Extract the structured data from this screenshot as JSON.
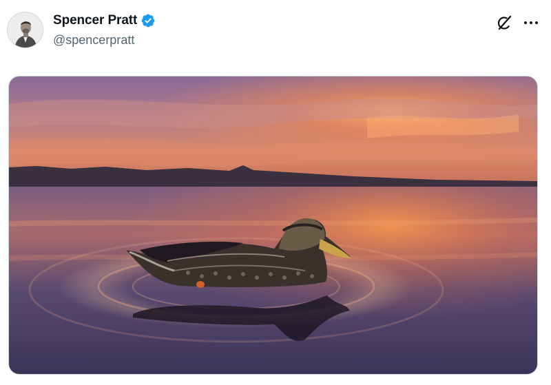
{
  "tweet": {
    "author": {
      "display_name": "Spencer Pratt",
      "handle": "@spencerpratt",
      "verified": true,
      "avatar_icon": "profile-photo"
    },
    "actions": {
      "grok_icon": "grok-icon",
      "more_icon": "more-options-icon"
    },
    "media": {
      "icon": "photo-duck-sunset"
    }
  },
  "colors": {
    "text_primary": "#0f1419",
    "text_secondary": "#536471",
    "verified_blue": "#1d9bf0"
  }
}
